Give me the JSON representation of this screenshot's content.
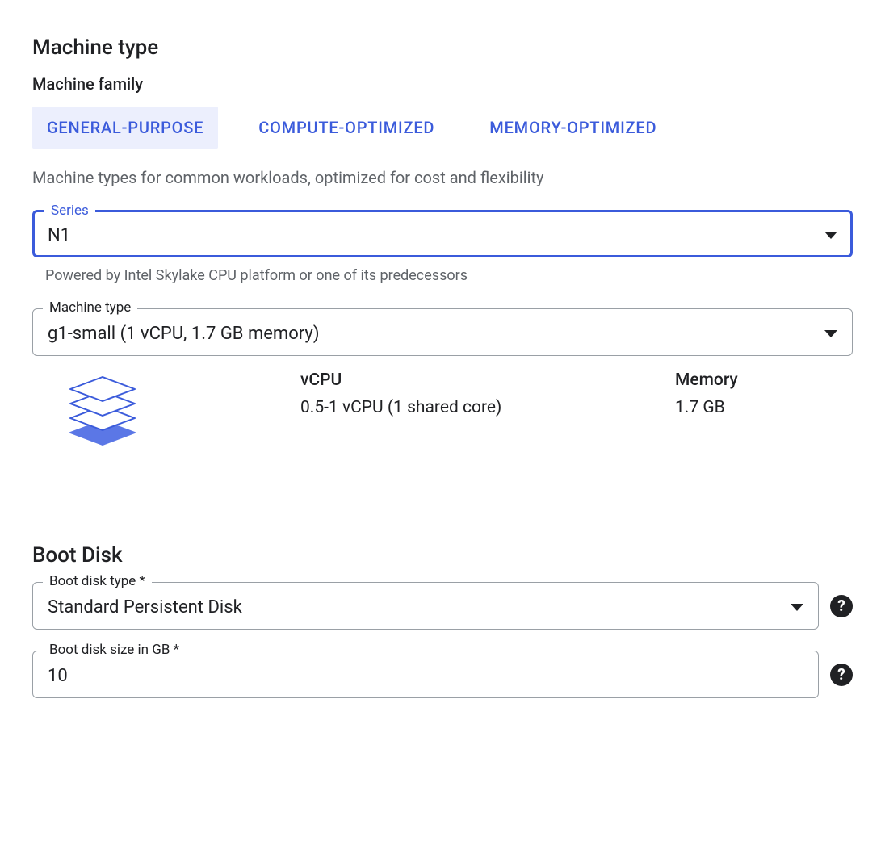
{
  "machine": {
    "section_title": "Machine type",
    "family_title": "Machine family",
    "tabs": [
      {
        "label": "GENERAL-PURPOSE",
        "selected": true
      },
      {
        "label": "COMPUTE-OPTIMIZED",
        "selected": false
      },
      {
        "label": "MEMORY-OPTIMIZED",
        "selected": false
      }
    ],
    "family_description": "Machine types for common workloads, optimized for cost and flexibility",
    "series": {
      "label": "Series",
      "value": "N1",
      "helper": "Powered by Intel Skylake CPU platform or one of its predecessors"
    },
    "type": {
      "label": "Machine type",
      "value": "g1-small (1 vCPU, 1.7 GB memory)"
    },
    "specs": {
      "vcpu_label": "vCPU",
      "vcpu_value": "0.5-1 vCPU (1 shared core)",
      "memory_label": "Memory",
      "memory_value": "1.7 GB"
    }
  },
  "boot": {
    "section_title": "Boot Disk",
    "disk_type": {
      "label": "Boot disk type *",
      "value": "Standard Persistent Disk"
    },
    "disk_size": {
      "label": "Boot disk size in GB *",
      "value": "10"
    }
  }
}
